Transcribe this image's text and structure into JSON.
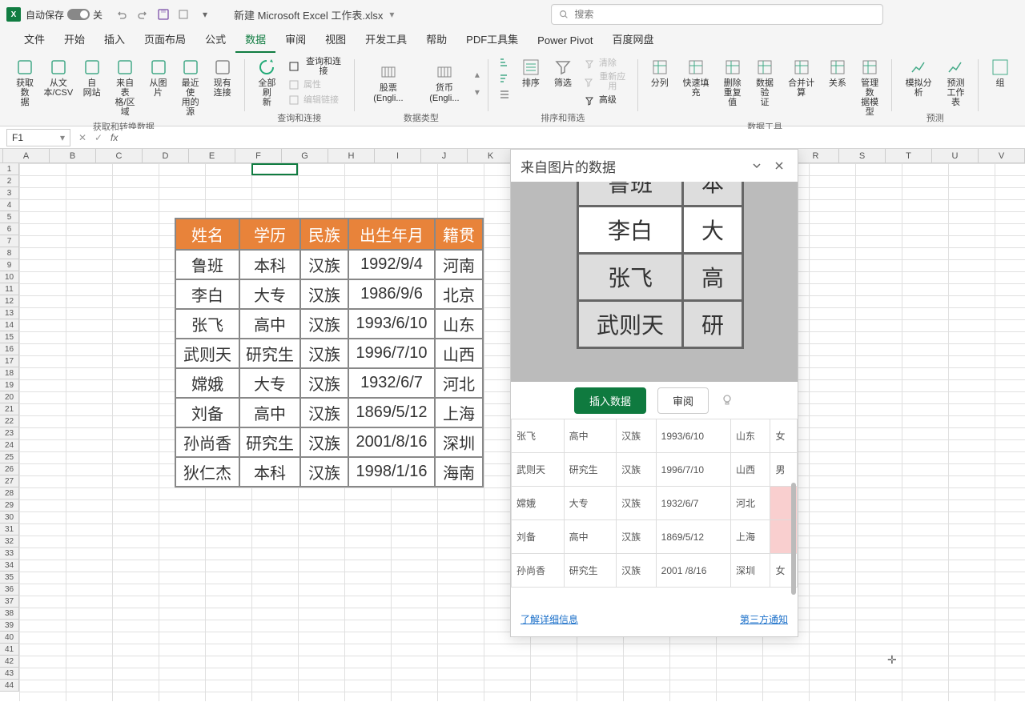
{
  "titlebar": {
    "autosave_label": "自动保存",
    "autosave_state": "关",
    "doc_name": "新建 Microsoft Excel 工作表.xlsx",
    "search_placeholder": "搜索"
  },
  "tabs": [
    "文件",
    "开始",
    "插入",
    "页面布局",
    "公式",
    "数据",
    "审阅",
    "视图",
    "开发工具",
    "帮助",
    "PDF工具集",
    "Power Pivot",
    "百度网盘"
  ],
  "active_tab": 5,
  "ribbon": {
    "g1": {
      "label": "获取和转换数据",
      "btns": [
        "获取数\n据",
        "从文\n本/CSV",
        "自\n网站",
        "来自表\n格/区域",
        "从图\n片",
        "最近使\n用的源",
        "现有\n连接"
      ]
    },
    "g2": {
      "label": "查询和连接",
      "main": "全部刷\n新",
      "items": [
        "查询和连接",
        "属性",
        "编辑链接"
      ]
    },
    "g3": {
      "label": "数据类型",
      "btns": [
        "股票 (Engli...",
        "货币 (Engli..."
      ]
    },
    "g4": {
      "label": "排序和筛选",
      "sort": "排序",
      "filter": "筛选",
      "items": [
        "清除",
        "重新应用",
        "高级"
      ]
    },
    "g5": {
      "label": "数据工具",
      "btns": [
        "分列",
        "快速填充",
        "删除\n重复值",
        "数据验\n证",
        "合并计算",
        "关系",
        "管理数\n据模型"
      ]
    },
    "g6": {
      "label": "预测",
      "btns": [
        "模拟分析",
        "预测\n工作表"
      ]
    },
    "g7": {
      "btn": "组"
    }
  },
  "namebox": "F1",
  "cols": [
    "A",
    "B",
    "C",
    "D",
    "E",
    "F",
    "G",
    "H",
    "I",
    "J",
    "K",
    "L",
    "M",
    "N",
    "O",
    "P",
    "Q",
    "R",
    "S",
    "T",
    "U",
    "V"
  ],
  "row_count": 44,
  "overlay": {
    "headers": [
      "姓名",
      "学历",
      "民族",
      "出生年月",
      "籍贯"
    ],
    "rows": [
      [
        "鲁班",
        "本科",
        "汉族",
        "1992/9/4",
        "河南"
      ],
      [
        "李白",
        "大专",
        "汉族",
        "1986/9/6",
        "北京"
      ],
      [
        "张飞",
        "高中",
        "汉族",
        "1993/6/10",
        "山东"
      ],
      [
        "武则天",
        "研究生",
        "汉族",
        "1996/7/10",
        "山西"
      ],
      [
        "嫦娥",
        "大专",
        "汉族",
        "1932/6/7",
        "河北"
      ],
      [
        "刘备",
        "高中",
        "汉族",
        "1869/5/12",
        "上海"
      ],
      [
        "孙尚香",
        "研究生",
        "汉族",
        "2001/8/16",
        "深圳"
      ],
      [
        "狄仁杰",
        "本科",
        "汉族",
        "1998/1/16",
        "海南"
      ]
    ]
  },
  "pane": {
    "title": "来自图片的数据",
    "insert_btn": "插入数据",
    "review_btn": "审阅",
    "preview_rows": [
      [
        "鲁班",
        "本"
      ],
      [
        "李白",
        "大"
      ],
      [
        "张飞",
        "高"
      ],
      [
        "武则天",
        "研"
      ]
    ],
    "preview_highlight_row": 1,
    "grid": [
      {
        "c": [
          "张飞",
          "高中",
          "汉族",
          "1993/6/10",
          "山东",
          "女"
        ],
        "err": []
      },
      {
        "c": [
          "武则天",
          "研究生",
          "汉族",
          "1996/7/10",
          "山西",
          "男"
        ],
        "err": []
      },
      {
        "c": [
          "嫦娥",
          "大专",
          "汉族",
          "1932/6/7",
          "河北",
          ""
        ],
        "err": [
          5
        ]
      },
      {
        "c": [
          "刘备",
          "高中",
          "汉族",
          "1869/5/12",
          "上海",
          ""
        ],
        "err": [
          5
        ]
      },
      {
        "c": [
          "孙尚香",
          "研究生",
          "汉族",
          "2001 /8/16",
          "深圳",
          "女"
        ],
        "err": []
      }
    ],
    "more_info": "了解详细信息",
    "third_party": "第三方通知"
  }
}
